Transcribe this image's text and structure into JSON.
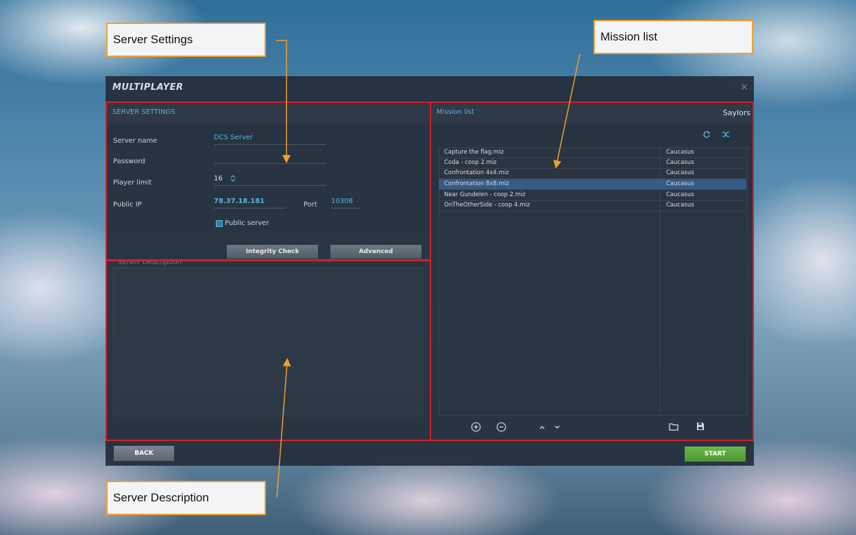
{
  "window": {
    "title": "MULTIPLAYER",
    "close_glyph": "×"
  },
  "server_settings": {
    "header": "SERVER SETTINGS",
    "server_name_label": "Server name",
    "server_name_value": "DCS Server",
    "password_label": "Password",
    "password_value": "",
    "player_limit_label": "Player limit",
    "player_limit_value": "16",
    "public_ip_label": "Public IP",
    "public_ip_value": "78.37.18.181",
    "port_label": "Port",
    "port_value": "10308",
    "public_server_label": "Public server",
    "public_server_checked": true,
    "integrity_check_label": "Integrity Check",
    "advanced_label": "Advanced"
  },
  "server_description": {
    "label": "Server Description"
  },
  "mission_list": {
    "header": "Mission list",
    "user": "Saylors",
    "rows": [
      {
        "name": "Capture the flag.miz",
        "map": "Caucasus",
        "selected": false
      },
      {
        "name": "Coda  - coop 2.miz",
        "map": "Caucasus",
        "selected": false
      },
      {
        "name": "Confrontation 4x4.miz",
        "map": "Caucasus",
        "selected": false
      },
      {
        "name": "Confrontation 8x8.miz",
        "map": "Caucasus",
        "selected": true
      },
      {
        "name": "Near Gundelen - coop 2.miz",
        "map": "Caucasus",
        "selected": false
      },
      {
        "name": "OnTheOtherSide - coop 4.miz",
        "map": "Caucasus",
        "selected": false
      }
    ]
  },
  "footer": {
    "back_label": "BACK",
    "start_label": "START"
  },
  "callouts": {
    "server_settings": "Server Settings",
    "mission_list": "Mission list",
    "server_description": "Server Description"
  },
  "colors": {
    "accent": "#5bb4d8",
    "highlight_box": "#d21f2a",
    "callout_border": "#f0a030",
    "start_button": "#5aa83a"
  },
  "icons": [
    "close-icon",
    "refresh-icon",
    "shuffle-icon",
    "add-icon",
    "remove-icon",
    "move-up-icon",
    "move-down-icon",
    "folder-icon",
    "save-icon",
    "spinner-icon",
    "checkbox-icon"
  ]
}
